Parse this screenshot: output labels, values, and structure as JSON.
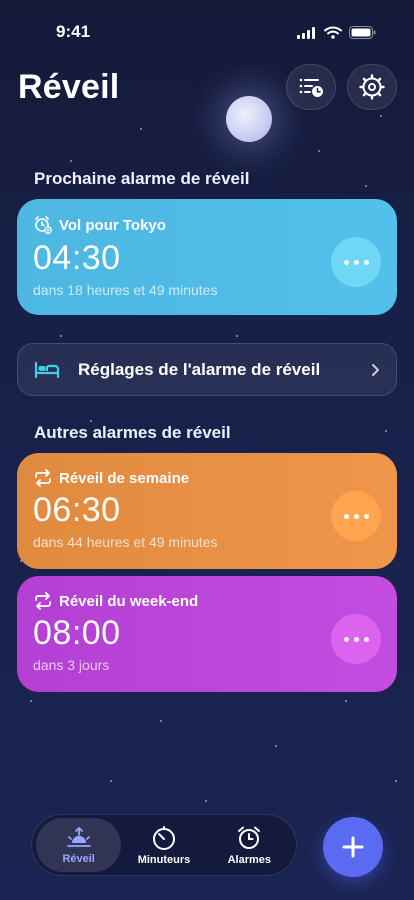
{
  "status_bar": {
    "time": "9:41"
  },
  "header": {
    "title": "Réveil"
  },
  "next_alarm": {
    "section_title": "Prochaine alarme de réveil",
    "label": "Vol pour Tokyo",
    "time": "04:30",
    "countdown": "dans 18 heures et 49 minutes",
    "color": "#4db7e2"
  },
  "settings_row": {
    "label": "Réglages de l'alarme de réveil"
  },
  "other_alarms": {
    "section_title": "Autres alarmes de réveil",
    "items": [
      {
        "label": "Réveil de semaine",
        "time": "06:30",
        "countdown": "dans 44 heures et 49 minutes",
        "color": "#e08a3f"
      },
      {
        "label": "Réveil du week-end",
        "time": "08:00",
        "countdown": "dans 3 jours",
        "color": "#b43fd4"
      }
    ]
  },
  "tabbar": {
    "tabs": [
      {
        "label": "Réveil",
        "icon": "sunrise-icon",
        "active": true
      },
      {
        "label": "Minuteurs",
        "icon": "timer-icon",
        "active": false
      },
      {
        "label": "Alarmes",
        "icon": "alarm-clock-icon",
        "active": false
      }
    ]
  },
  "colors": {
    "accent": "#5a6bf2",
    "background": "#161d43"
  }
}
